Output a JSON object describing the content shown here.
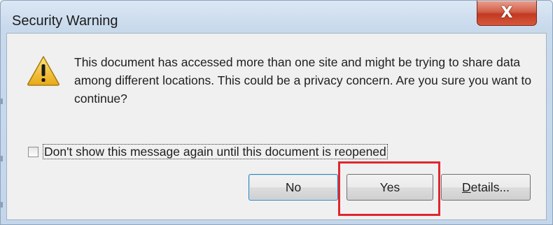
{
  "dialog": {
    "title": "Security Warning",
    "close_label": "X",
    "message": "This document has accessed more than one site and might be trying to share data among different locations. This could be a privacy concern. Are you sure you want to continue?",
    "checkbox": {
      "label": "Don't show this message again until this document is reopened",
      "checked": false
    },
    "buttons": {
      "no": "No",
      "yes": "Yes",
      "details": "Details..."
    },
    "icon": "warning-triangle-icon",
    "colors": {
      "highlight": "#e0262f",
      "close_button": "#c23a22",
      "warning_yellow": "#f2c230"
    }
  }
}
